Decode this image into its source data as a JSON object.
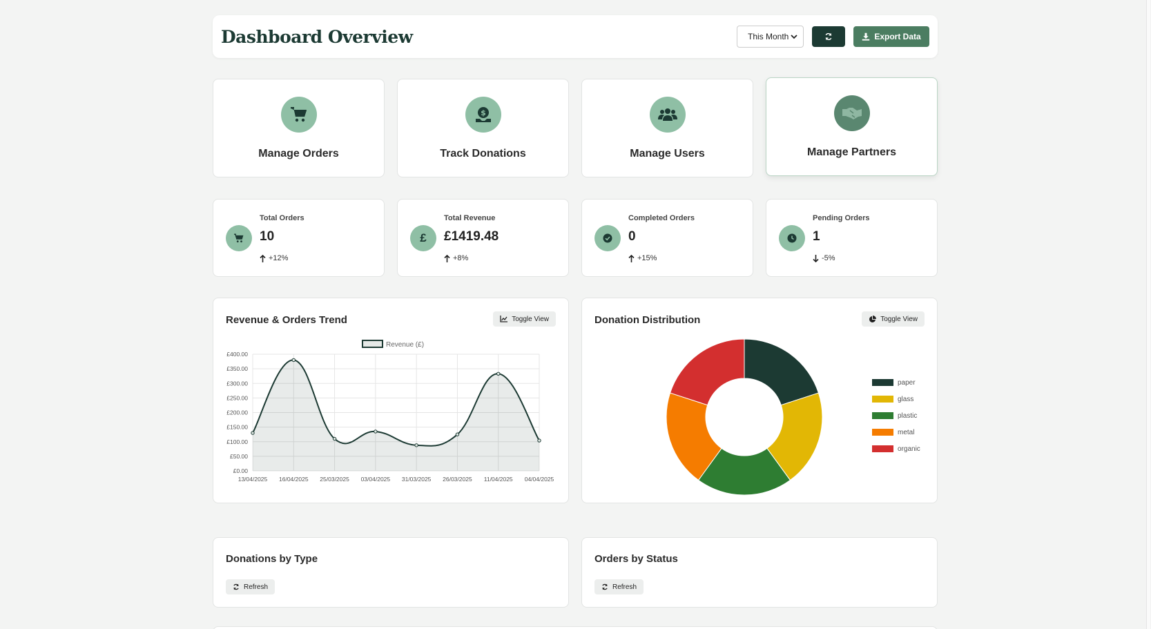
{
  "header": {
    "title": "Dashboard Overview",
    "period_select": "This Month",
    "export_label": "Export Data"
  },
  "actions": [
    {
      "label": "Manage Orders",
      "icon": "cart-icon"
    },
    {
      "label": "Track Donations",
      "icon": "donation-icon"
    },
    {
      "label": "Manage Users",
      "icon": "users-icon"
    },
    {
      "label": "Manage Partners",
      "icon": "handshake-icon"
    }
  ],
  "stats": [
    {
      "title": "Total Orders",
      "value": "10",
      "change": "+12%",
      "direction": "up",
      "icon": "cart-icon"
    },
    {
      "title": "Total Revenue",
      "value": "£1419.48",
      "change": "+8%",
      "direction": "up",
      "icon": "pound-icon",
      "glyph": "£"
    },
    {
      "title": "Completed Orders",
      "value": "0",
      "change": "+15%",
      "direction": "up",
      "icon": "check-circle-icon"
    },
    {
      "title": "Pending Orders",
      "value": "1",
      "change": "-5%",
      "direction": "down",
      "icon": "clock-icon"
    }
  ],
  "charts": {
    "trend": {
      "title": "Revenue & Orders Trend",
      "toggle_label": "Toggle View"
    },
    "donation": {
      "title": "Donation Distribution",
      "toggle_label": "Toggle View"
    }
  },
  "bottom": [
    {
      "title": "Donations by Type",
      "refresh_label": "Refresh"
    },
    {
      "title": "Orders by Status",
      "refresh_label": "Refresh"
    }
  ],
  "colors": {
    "primary": "#1c3a33",
    "accent": "#4b7d61",
    "icon_bg": "#8fbfa5"
  },
  "chart_data": [
    {
      "type": "line",
      "legend": [
        "Revenue (£)"
      ],
      "categories": [
        "13/04/2025",
        "16/04/2025",
        "25/03/2025",
        "03/04/2025",
        "31/03/2025",
        "26/03/2025",
        "11/04/2025",
        "04/04/2025"
      ],
      "series": [
        {
          "name": "Revenue (£)",
          "values": [
            130,
            380,
            110,
            135,
            88,
            125,
            333,
            104
          ]
        }
      ],
      "ylim": [
        0,
        400
      ],
      "yticks": [
        "£0.00",
        "£50.00",
        "£100.00",
        "£150.00",
        "£200.00",
        "£250.00",
        "£300.00",
        "£350.00",
        "£400.00"
      ],
      "grid": true,
      "legend_position": "top",
      "fill": "area",
      "line_color": "#1c3a33"
    },
    {
      "type": "pie",
      "variant": "doughnut",
      "categories": [
        "paper",
        "glass",
        "plastic",
        "metal",
        "organic"
      ],
      "values": [
        20,
        20,
        20,
        20,
        20
      ],
      "colors": [
        "#1c3a33",
        "#e2b705",
        "#2e7d32",
        "#f57c00",
        "#d32f2f"
      ],
      "legend_position": "right"
    }
  ]
}
